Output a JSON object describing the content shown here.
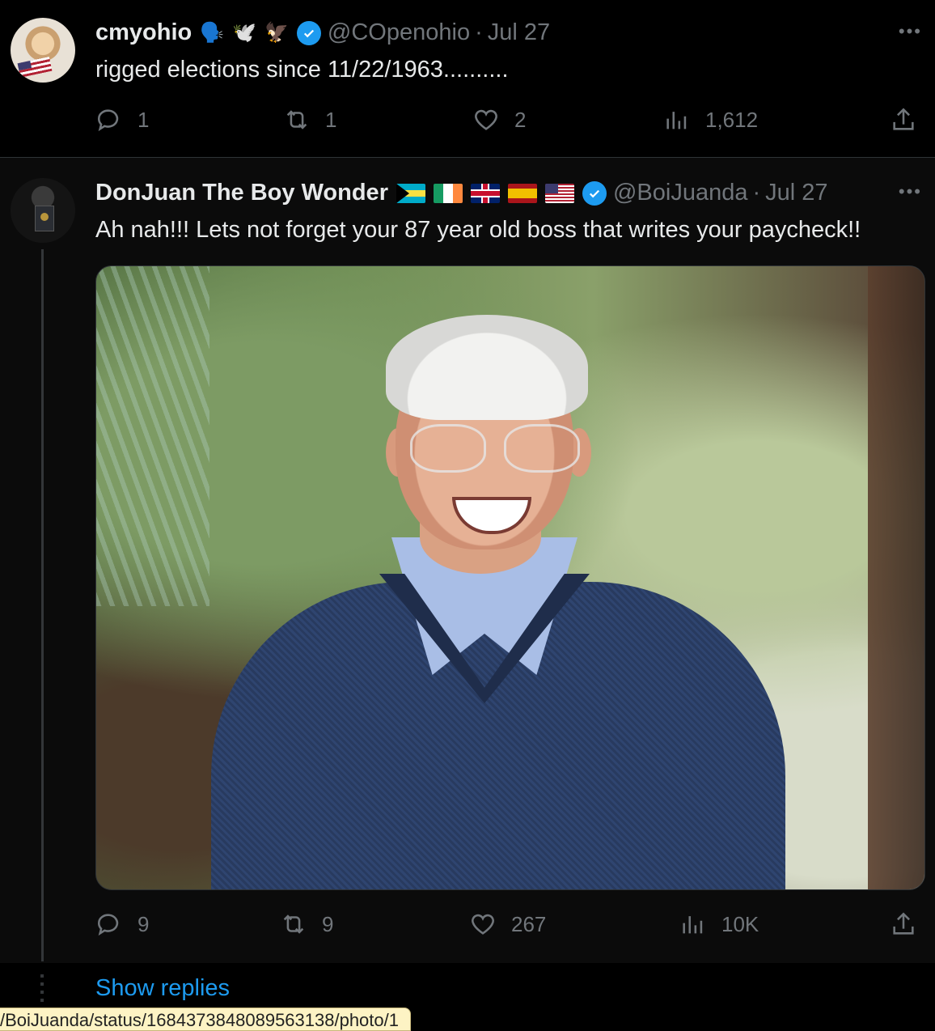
{
  "tweet1": {
    "name": "cmyohio",
    "name_emojis": [
      "🗣️",
      "🕊️",
      "🦅"
    ],
    "handle": "@COpenohio",
    "separator": "·",
    "date": "Jul 27",
    "text": "rigged elections since 11/22/1963..........",
    "replies": "1",
    "reposts": "1",
    "likes": "2",
    "views": "1,612"
  },
  "tweet2": {
    "name": "DonJuan The Boy Wonder",
    "flags": [
      "bahamas-flag",
      "ireland-flag",
      "uk-flag",
      "spain-flag",
      "us-flag"
    ],
    "handle": "@BoiJuanda",
    "separator": "·",
    "date": "Jul 27",
    "text": "Ah nah!!! Lets not forget your 87 year old boss that writes your paycheck!!",
    "replies": "9",
    "reposts": "9",
    "likes": "267",
    "views": "10K"
  },
  "show_replies_label": "Show replies",
  "status_url": "/BoiJuanda/status/1684373848089563138/photo/1",
  "colors": {
    "background": "#000000",
    "text": "#e7e9ea",
    "secondary": "#71767b",
    "accent": "#1d9bf0"
  },
  "icons": [
    "reply-icon",
    "repost-icon",
    "like-icon",
    "views-icon",
    "share-icon",
    "more-icon",
    "verified-icon"
  ]
}
